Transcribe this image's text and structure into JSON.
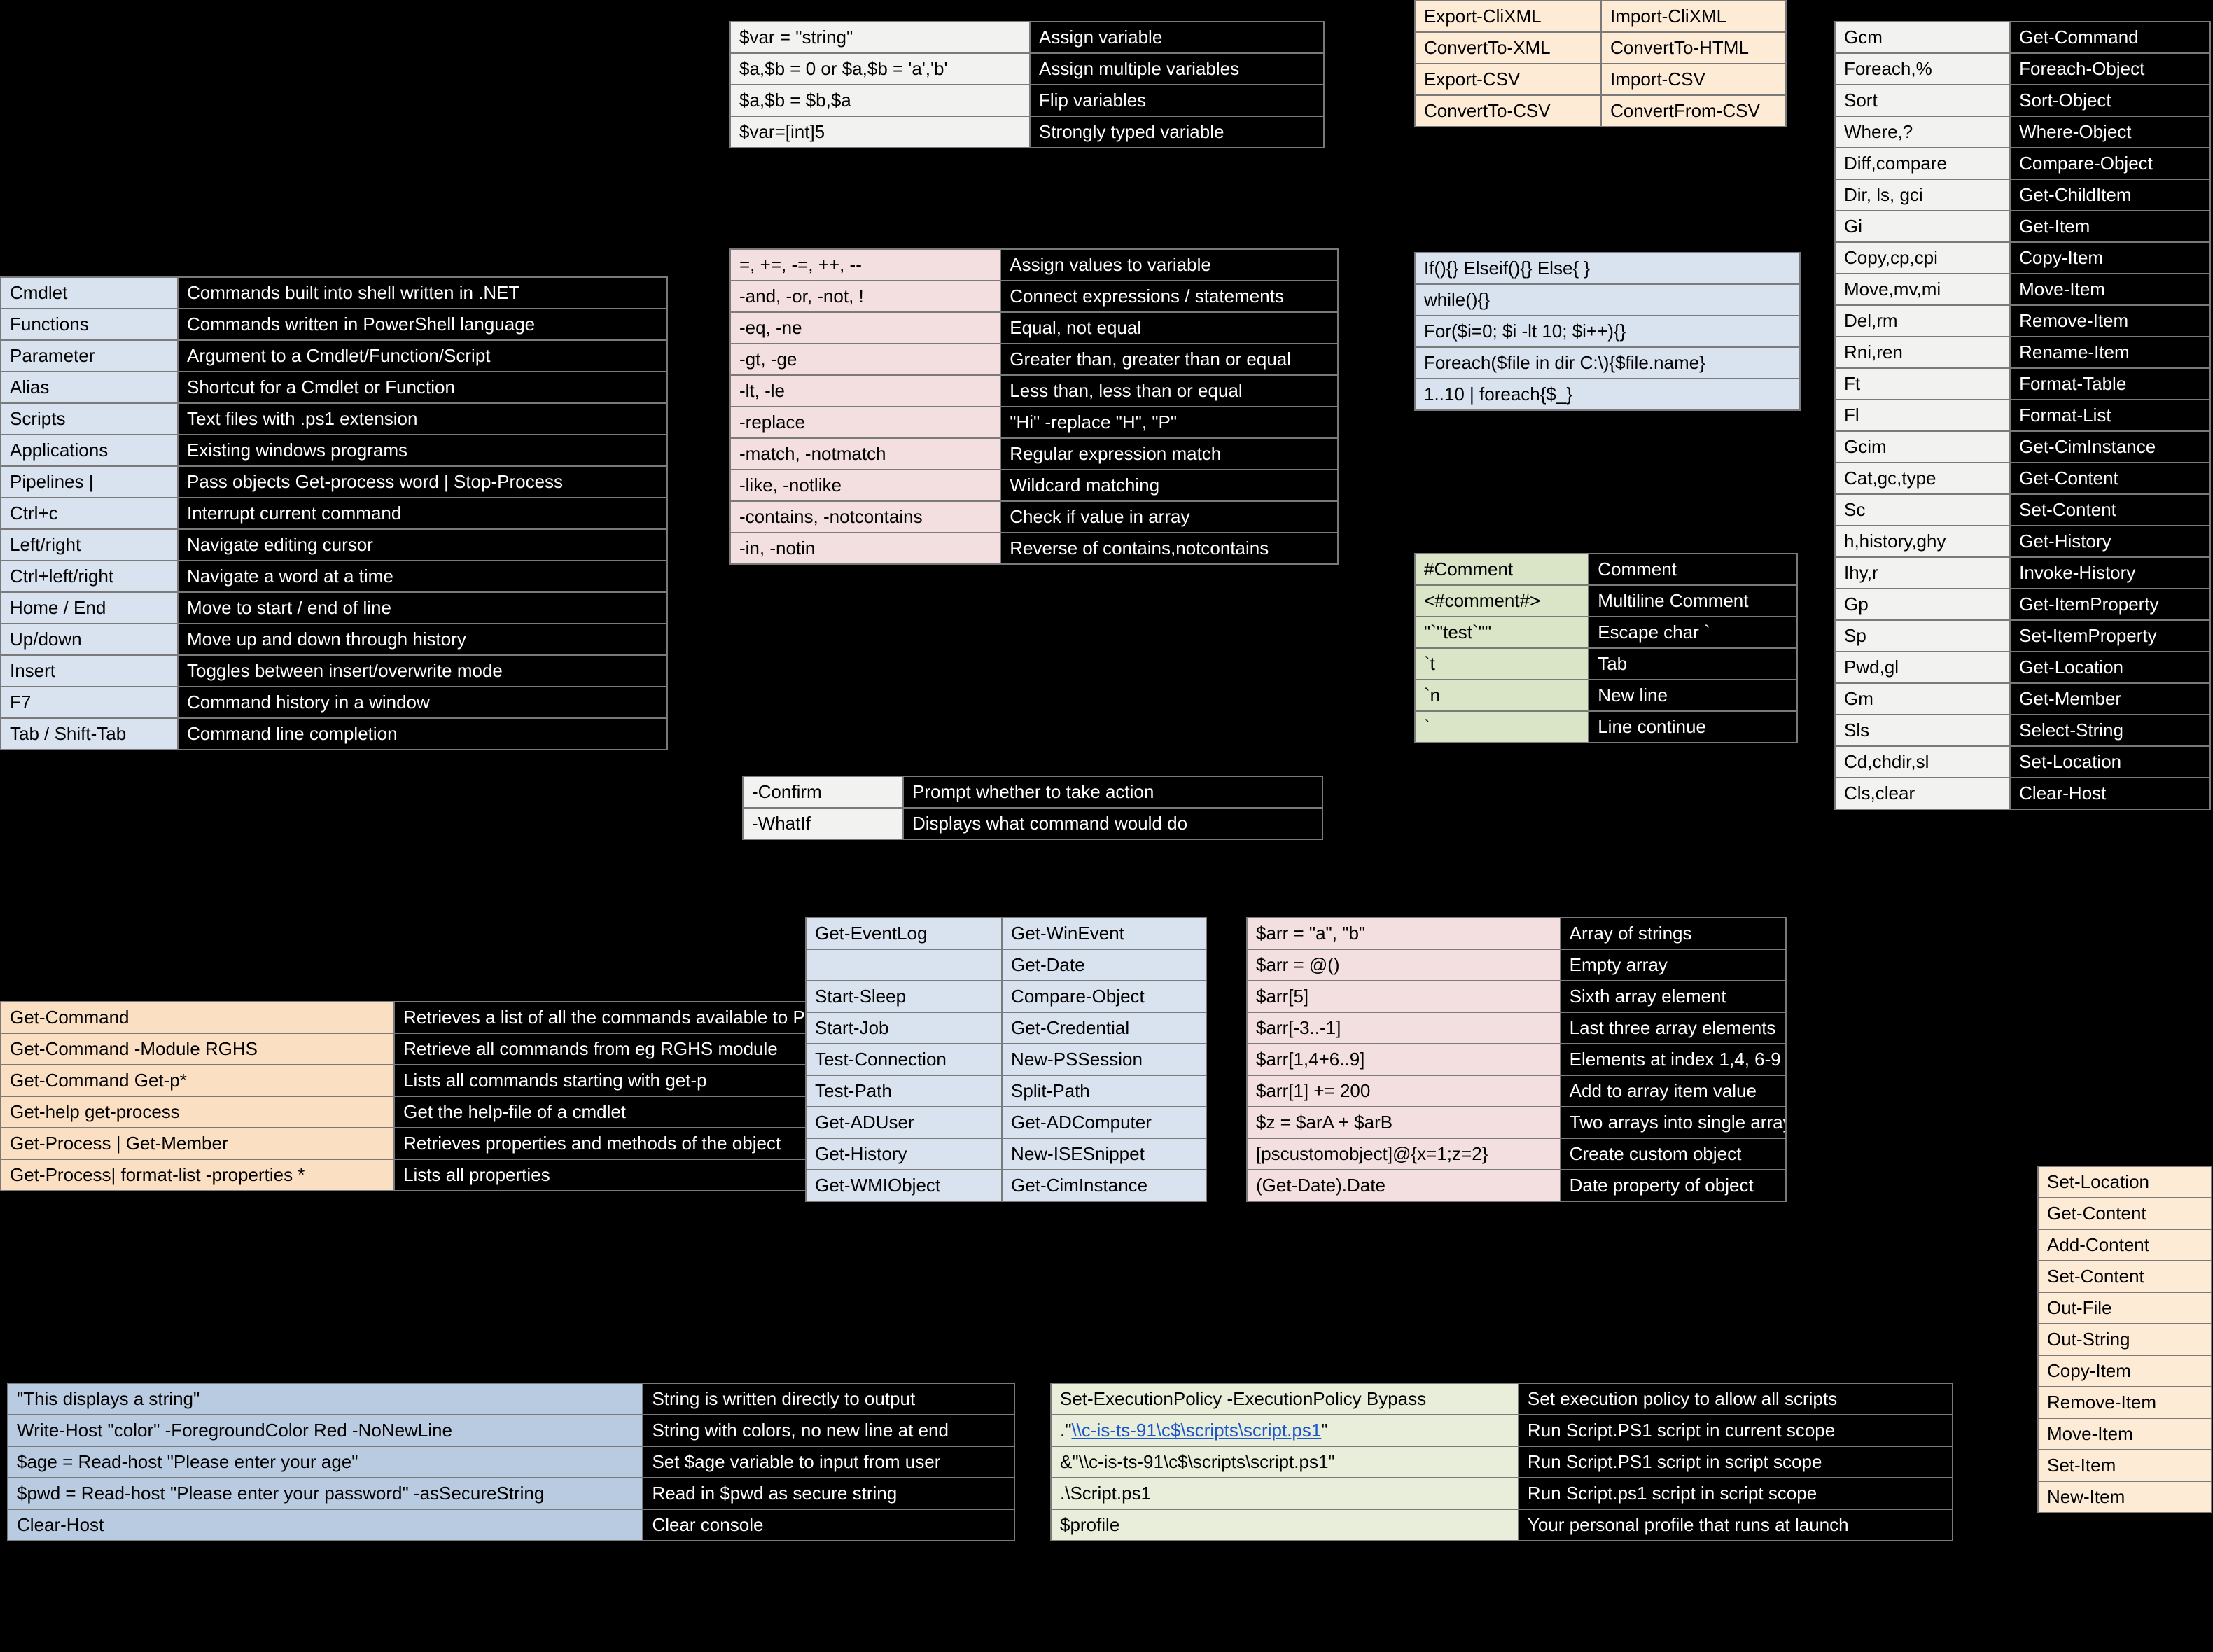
{
  "concepts": {
    "rows": [
      [
        "Cmdlet",
        "Commands built into shell written in .NET"
      ],
      [
        "Functions",
        "Commands written in PowerShell language"
      ],
      [
        "Parameter",
        "Argument to a Cmdlet/Function/Script"
      ],
      [
        "Alias",
        "Shortcut for a Cmdlet or Function"
      ],
      [
        "Scripts",
        "Text files with .ps1 extension"
      ],
      [
        "Applications",
        "Existing windows programs"
      ],
      [
        "Pipelines |",
        "Pass objects Get-process word | Stop-Process"
      ],
      [
        "Ctrl+c",
        "Interrupt current command"
      ],
      [
        "Left/right",
        "Navigate editing cursor"
      ],
      [
        "Ctrl+left/right",
        "Navigate a word at a time"
      ],
      [
        "Home / End",
        "Move to start / end of line"
      ],
      [
        "Up/down",
        "Move up and down through history"
      ],
      [
        "Insert",
        "Toggles between insert/overwrite mode"
      ],
      [
        "F7",
        "Command history in a window"
      ],
      [
        "Tab / Shift-Tab",
        "Command line completion"
      ]
    ]
  },
  "help": {
    "rows": [
      [
        "Get-Command",
        "Retrieves a list of all the commands available to PowerShell (native binaries in $env:PATH + cmdlets / functions from modules)"
      ],
      [
        "Get-Command -Module RGHS",
        "Retrieve all commands from eg RGHS module"
      ],
      [
        "Get-Command Get-p*",
        "Lists all commands starting with get-p"
      ],
      [
        "Get-help get-process",
        "Get the help-file of a cmdlet"
      ],
      [
        "Get-Process | Get-Member",
        "Retrieves properties and methods of the object"
      ],
      [
        "Get-Process| format-list -properties *",
        "Lists all properties"
      ]
    ]
  },
  "output": {
    "rows": [
      [
        "\"This displays a string\"",
        "String is written directly to output"
      ],
      [
        "Write-Host \"color\" -ForegroundColor Red -NoNewLine",
        "String with colors, no new line at end"
      ],
      [
        "$age = Read-host \"Please enter your age\"",
        "Set $age variable to input from user"
      ],
      [
        "$pwd = Read-host \"Please enter your password\" -asSecureString",
        "Read in $pwd as secure string"
      ],
      [
        "Clear-Host",
        "Clear console"
      ]
    ]
  },
  "vars": {
    "rows": [
      [
        "$var = \"string\"",
        "Assign variable"
      ],
      [
        "$a,$b = 0 or $a,$b = 'a','b'",
        "Assign multiple variables"
      ],
      [
        "$a,$b = $b,$a",
        "Flip variables"
      ],
      [
        "$var=[int]5",
        "Strongly typed variable"
      ]
    ]
  },
  "ops": {
    "rows": [
      [
        "=, +=, -=, ++, --",
        "Assign values to variable"
      ],
      [
        "-and, -or, -not, !",
        "Connect expressions / statements"
      ],
      [
        "-eq, -ne",
        "Equal, not equal"
      ],
      [
        "-gt, -ge",
        "Greater than, greater than or equal"
      ],
      [
        "-lt, -le",
        "Less than, less than or equal"
      ],
      [
        "-replace",
        "\"Hi\" -replace \"H\", \"P\""
      ],
      [
        "-match, -notmatch",
        "Regular expression match"
      ],
      [
        "-like, -notlike",
        "Wildcard matching"
      ],
      [
        "-contains, -notcontains",
        "Check if value in array"
      ],
      [
        "-in, -notin",
        "Reverse of contains,notcontains"
      ]
    ]
  },
  "params": {
    "rows": [
      [
        "-Confirm",
        "Prompt whether to take action"
      ],
      [
        "-WhatIf",
        "Displays what command would do"
      ]
    ]
  },
  "cmds": {
    "rows": [
      [
        "Get-EventLog",
        "Get-WinEvent"
      ],
      [
        "",
        "Get-Date"
      ],
      [
        "Start-Sleep",
        "Compare-Object"
      ],
      [
        "Start-Job",
        "Get-Credential"
      ],
      [
        "Test-Connection",
        "New-PSSession"
      ],
      [
        "Test-Path",
        "Split-Path"
      ],
      [
        "Get-ADUser",
        "Get-ADComputer"
      ],
      [
        "Get-History",
        "New-ISESnippet"
      ],
      [
        "Get-WMIObject",
        "Get-CimInstance"
      ]
    ]
  },
  "import": {
    "rows": [
      [
        "Export-CliXML",
        "Import-CliXML"
      ],
      [
        "ConvertTo-XML",
        "ConvertTo-HTML"
      ],
      [
        "Export-CSV",
        "Import-CSV"
      ],
      [
        "ConvertTo-CSV",
        "ConvertFrom-CSV"
      ]
    ]
  },
  "flow": {
    "rows": [
      "If(){} Elseif(){} Else{ }",
      "while(){}",
      "For($i=0; $i -lt 10; $i++){}",
      "Foreach($file in dir C:\\){$file.name}",
      "1..10 | foreach{$_}"
    ]
  },
  "esc": {
    "rows": [
      [
        "#Comment",
        "Comment"
      ],
      [
        "<#comment#>",
        "Multiline Comment"
      ],
      [
        "\"`\"test`\"\"",
        "Escape char `"
      ],
      [
        "`t",
        "Tab"
      ],
      [
        "`n",
        "New line"
      ],
      [
        "`",
        "Line continue"
      ]
    ]
  },
  "arr": {
    "rows": [
      [
        "$arr = \"a\", \"b\"",
        "Array of strings"
      ],
      [
        "$arr = @()",
        "Empty array"
      ],
      [
        "$arr[5]",
        "Sixth array element"
      ],
      [
        "$arr[-3..-1]",
        "Last three array elements"
      ],
      [
        "$arr[1,4+6..9]",
        "Elements at index 1,4, 6-9"
      ],
      [
        "$arr[1] += 200",
        "Add to array item value"
      ],
      [
        "$z = $arA + $arB",
        "Two arrays into single array"
      ],
      [
        "[pscustomobject]@{x=1;z=2}",
        "Create custom object"
      ],
      [
        "(Get-Date).Date",
        "Date property of object"
      ]
    ]
  },
  "scripts": {
    "rows": [
      [
        "Set-ExecutionPolicy -ExecutionPolicy Bypass",
        "Set execution policy to allow all scripts"
      ],
      [
        ".\"\\\\c-is-ts-91\\c$\\scripts\\script.ps1\"",
        "Run Script.PS1 script in current scope"
      ],
      [
        "&\"\\\\c-is-ts-91\\c$\\scripts\\script.ps1\"",
        "Run Script.PS1 script in script scope"
      ],
      [
        ".\\Script.ps1",
        "Run Script.ps1 script in script scope"
      ],
      [
        "$profile",
        "Your personal profile that runs at launch"
      ]
    ],
    "linkrow": 1
  },
  "alias": {
    "rows": [
      [
        "Gcm",
        "Get-Command"
      ],
      [
        "Foreach,%",
        "Foreach-Object"
      ],
      [
        "Sort",
        "Sort-Object"
      ],
      [
        "Where,?",
        "Where-Object"
      ],
      [
        "Diff,compare",
        "Compare-Object"
      ],
      [
        "Dir, ls, gci",
        "Get-ChildItem"
      ],
      [
        "Gi",
        "Get-Item"
      ],
      [
        "Copy,cp,cpi",
        "Copy-Item"
      ],
      [
        "Move,mv,mi",
        "Move-Item"
      ],
      [
        "Del,rm",
        "Remove-Item"
      ],
      [
        "Rni,ren",
        "Rename-Item"
      ],
      [
        "Ft",
        "Format-Table"
      ],
      [
        "Fl",
        "Format-List"
      ],
      [
        "Gcim",
        "Get-CimInstance"
      ],
      [
        "Cat,gc,type",
        "Get-Content"
      ],
      [
        "Sc",
        "Set-Content"
      ],
      [
        "h,history,ghy",
        "Get-History"
      ],
      [
        "Ihy,r",
        "Invoke-History"
      ],
      [
        "Gp",
        "Get-ItemProperty"
      ],
      [
        "Sp",
        "Set-ItemProperty"
      ],
      [
        "Pwd,gl",
        "Get-Location"
      ],
      [
        "Gm",
        "Get-Member"
      ],
      [
        "Sls",
        "Select-String"
      ],
      [
        "Cd,chdir,sl",
        "Set-Location"
      ],
      [
        "Cls,clear",
        "Clear-Host"
      ]
    ]
  },
  "cmdlist": {
    "rows": [
      "Set-Location",
      "Get-Content",
      "Add-Content",
      "Set-Content",
      "Out-File",
      "Out-String",
      "Copy-Item",
      "Remove-Item",
      "Move-Item",
      "Set-Item",
      "New-Item"
    ]
  }
}
